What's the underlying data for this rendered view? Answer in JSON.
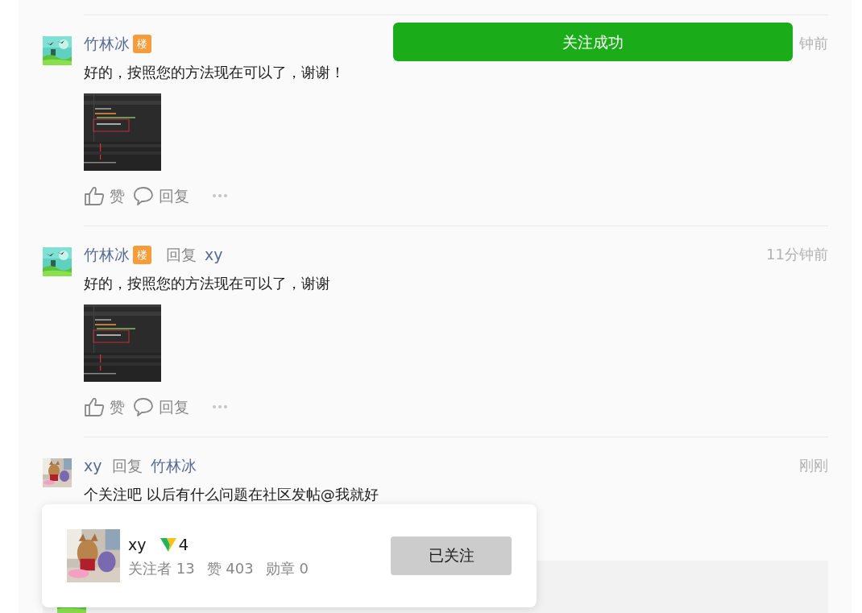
{
  "toast": {
    "text": "关注成功"
  },
  "comments": [
    {
      "author": "竹林冰",
      "badge": "楼",
      "time": "钟前",
      "text": "好的，按照您的方法现在可以了，谢谢！",
      "actions": [
        {
          "kind": "like",
          "label": "赞"
        },
        {
          "kind": "reply",
          "label": "回复"
        },
        {
          "kind": "more"
        }
      ]
    },
    {
      "author": "竹林冰",
      "badge": "楼",
      "reply_label": "回复",
      "reply_to": "xy",
      "time": "11分钟前",
      "text": "好的，按照您的方法现在可以了，谢谢",
      "actions": [
        {
          "kind": "like",
          "label": "赞"
        },
        {
          "kind": "reply",
          "label": "回复"
        },
        {
          "kind": "more"
        }
      ]
    },
    {
      "author": "xy",
      "reply_label": "回复",
      "reply_to": "竹林冰",
      "time": "刚刚",
      "text": "个关注吧 以后有什么问题在社区发帖@我就好"
    }
  ],
  "profile_popup": {
    "name": "xy",
    "level": "4",
    "stats": [
      "关注者 13",
      "赞 403",
      "勋章 0"
    ],
    "follow_button": {
      "label": "已关注",
      "following": true
    }
  }
}
